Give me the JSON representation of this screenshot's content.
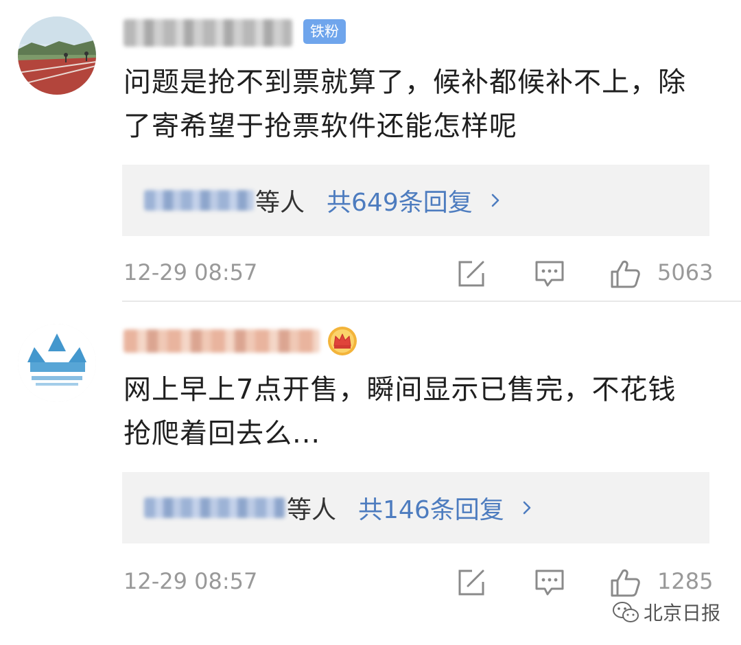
{
  "comments": [
    {
      "badge": "铁粉",
      "text": "问题是抢不到票就算了，候补都候补不上，除了寄希望于抢票软件还能怎样呢",
      "replies_suffix": "等人",
      "replies_count_label": "共649条回复",
      "time": "12-29 08:57",
      "likes": "5063"
    },
    {
      "text": "网上早上7点开售，瞬间显示已售完，不花钱抢爬着回去么...",
      "replies_suffix": "等人",
      "replies_count_label": "共146条回复",
      "time": "12-29 08:57",
      "likes": "1285"
    }
  ],
  "watermark": {
    "text": "北京日报"
  },
  "colors": {
    "accent": "#4d7cbf",
    "badge": "#6fa5ec",
    "meta_text": "#999999",
    "reply_bg": "#f2f2f2"
  }
}
